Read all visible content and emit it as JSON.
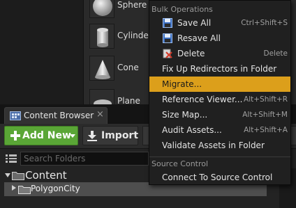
{
  "place_actors": {
    "items": [
      {
        "label": "Sphere",
        "icon": "sphere-icon"
      },
      {
        "label": "Cylinder",
        "icon": "cylinder-icon"
      },
      {
        "label": "Cone",
        "icon": "cone-icon"
      },
      {
        "label": "Plane",
        "icon": "plane-icon"
      }
    ]
  },
  "content_browser": {
    "tab_label": "Content Browser",
    "close_glyph": "×",
    "toolbar": {
      "add_new_label": "Add New",
      "import_label": "Import"
    },
    "search": {
      "placeholder": "Search Folders",
      "value": ""
    },
    "tree": {
      "root_label": "Content",
      "items": [
        {
          "label": "PolygonCity",
          "selected": true
        }
      ]
    }
  },
  "context_menu": {
    "sections": [
      {
        "heading": "Bulk Operations",
        "items": [
          {
            "label": "Save All",
            "shortcut": "Ctrl+Shift+S",
            "icon": "save-icon"
          },
          {
            "label": "Resave All",
            "shortcut": "",
            "icon": "save-icon"
          },
          {
            "label": "Delete",
            "shortcut": "Delete",
            "icon": "delete-icon"
          },
          {
            "label": "Fix Up Redirectors in Folder",
            "shortcut": ""
          },
          {
            "label": "Migrate...",
            "shortcut": "",
            "highlighted": true
          },
          {
            "label": "Reference Viewer...",
            "shortcut": "Alt+Shift+R"
          },
          {
            "label": "Size Map...",
            "shortcut": "Alt+Shift+M"
          },
          {
            "label": "Audit Assets...",
            "shortcut": "Alt+Shift+A"
          },
          {
            "label": "Validate Assets in Folder",
            "shortcut": ""
          }
        ]
      },
      {
        "heading": "Source Control",
        "items": [
          {
            "label": "Connect To Source Control",
            "shortcut": ""
          }
        ]
      }
    ]
  },
  "colors": {
    "highlight": "#dc9f1b",
    "add_new_green": "#5aa636",
    "menu_bg": "#202020"
  }
}
